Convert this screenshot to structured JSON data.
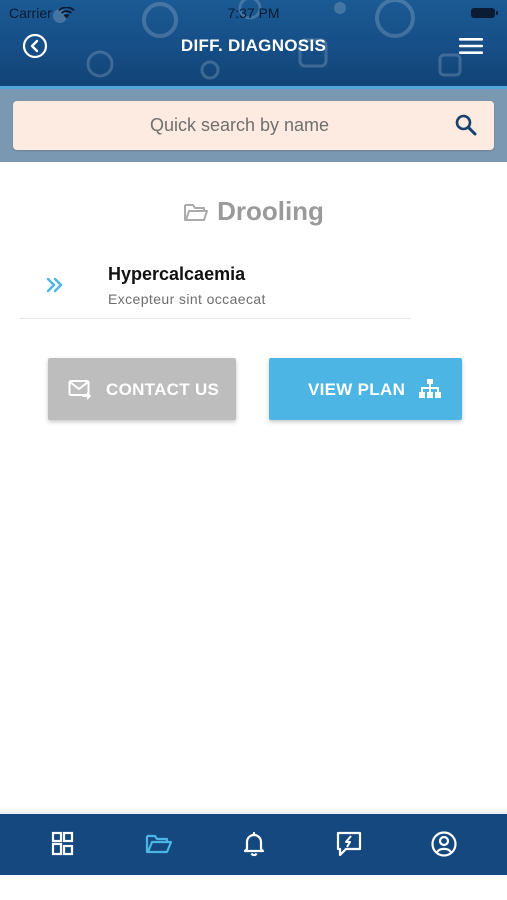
{
  "status_bar": {
    "carrier": "Carrier",
    "time": "7:37 PM"
  },
  "header": {
    "title": "DIFF. DIAGNOSIS",
    "back_icon": "back-circle-icon",
    "menu_icon": "hamburger-menu-icon"
  },
  "search": {
    "placeholder": "Quick search by name",
    "value": "",
    "icon": "search-icon"
  },
  "section": {
    "title": "Drooling",
    "icon": "folder-open-icon"
  },
  "list": [
    {
      "title": "Hypercalcaemia",
      "subtitle": "Excepteur sint occaecat",
      "icon": "double-chevron-right-icon"
    }
  ],
  "buttons": {
    "contact": {
      "label": "CONTACT US",
      "icon": "mail-forward-icon"
    },
    "plan": {
      "label": "VIEW PLAN",
      "icon": "sitemap-icon"
    }
  },
  "tabbar": {
    "items": [
      {
        "name": "dashboard",
        "icon": "dashboard-grid-icon",
        "active": false
      },
      {
        "name": "folders",
        "icon": "folder-open-icon",
        "active": true
      },
      {
        "name": "notifications",
        "icon": "bell-icon",
        "active": false
      },
      {
        "name": "feedback",
        "icon": "feedback-icon",
        "active": false
      },
      {
        "name": "profile",
        "icon": "user-circle-icon",
        "active": false
      }
    ]
  },
  "colors": {
    "header": "#164e86",
    "accent": "#4db5e4",
    "search_bg": "#fdebe1",
    "contact_button": "#bdbdbd",
    "tab_active": "#4db5e4"
  }
}
